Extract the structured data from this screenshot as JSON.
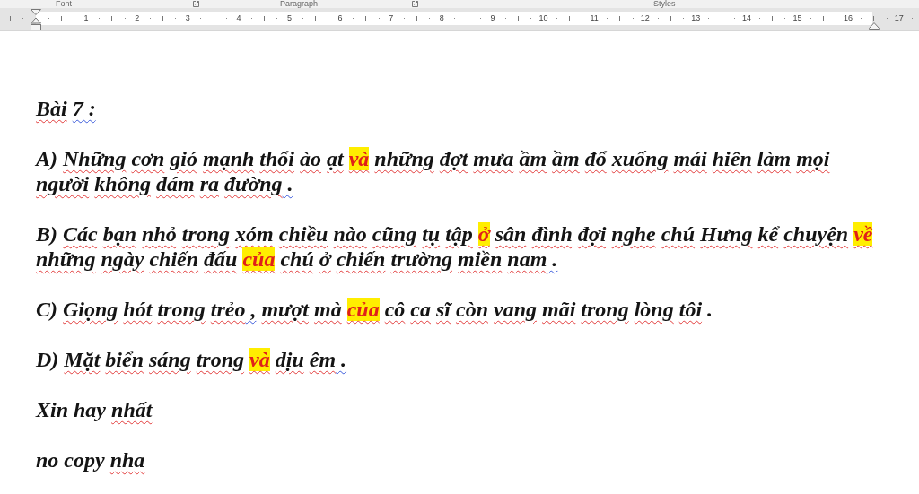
{
  "ribbon": {
    "groups": [
      {
        "label": "Font",
        "launcher": true
      },
      {
        "label": "Paragraph",
        "launcher": true
      },
      {
        "label": "Styles",
        "launcher": false
      }
    ]
  },
  "ruler": {
    "labels": [
      "1",
      "2",
      "3",
      "4",
      "5",
      "6",
      "7",
      "8",
      "9",
      "10",
      "11",
      "12",
      "13",
      "14",
      "15",
      "16",
      "17"
    ]
  },
  "document": {
    "title": {
      "runs": [
        {
          "text": "Bài ",
          "highlighted": false,
          "misspelled": true,
          "grammar_flag": false
        },
        {
          "text": "7 :",
          "highlighted": false,
          "misspelled": false,
          "grammar_flag": true
        }
      ]
    },
    "paragraphs": [
      {
        "runs": [
          {
            "text": "A) ",
            "highlighted": false,
            "misspelled": false,
            "grammar_flag": false
          },
          {
            "text": "Những cơn gió mạnh thổi ào ạt ",
            "highlighted": false,
            "misspelled": true,
            "grammar_flag": false
          },
          {
            "text": "và",
            "highlighted": true,
            "misspelled": true,
            "grammar_flag": false
          },
          {
            "text": " những đợt mưa ầm ầm đổ xuống mái hiên làm mọi người không dám ra đường",
            "highlighted": false,
            "misspelled": true,
            "grammar_flag": false
          },
          {
            "text": " .",
            "highlighted": false,
            "misspelled": false,
            "grammar_flag": true
          }
        ]
      },
      {
        "runs": [
          {
            "text": "B) ",
            "highlighted": false,
            "misspelled": false,
            "grammar_flag": false
          },
          {
            "text": "Các bạn nhỏ trong xóm chiều nào cũng tụ tập ",
            "highlighted": false,
            "misspelled": true,
            "grammar_flag": false
          },
          {
            "text": "ở",
            "highlighted": true,
            "misspelled": true,
            "grammar_flag": false
          },
          {
            "text": " sân đình đợi nghe chú Hưng kể chuyện ",
            "highlighted": false,
            "misspelled": true,
            "grammar_flag": false
          },
          {
            "text": "về",
            "highlighted": true,
            "misspelled": true,
            "grammar_flag": false
          },
          {
            "text": " những ngày chiến đấu ",
            "highlighted": false,
            "misspelled": true,
            "grammar_flag": false
          },
          {
            "text": "của",
            "highlighted": true,
            "misspelled": true,
            "grammar_flag": false
          },
          {
            "text": " chú ở chiến trường miền nam",
            "highlighted": false,
            "misspelled": true,
            "grammar_flag": false
          },
          {
            "text": " .",
            "highlighted": false,
            "misspelled": false,
            "grammar_flag": true
          }
        ]
      },
      {
        "runs": [
          {
            "text": "C) ",
            "highlighted": false,
            "misspelled": false,
            "grammar_flag": false
          },
          {
            "text": "Giọng hót trong trẻo",
            "highlighted": false,
            "misspelled": true,
            "grammar_flag": false
          },
          {
            "text": " ,",
            "highlighted": false,
            "misspelled": false,
            "grammar_flag": true
          },
          {
            "text": " mượt mà ",
            "highlighted": false,
            "misspelled": true,
            "grammar_flag": false
          },
          {
            "text": "của",
            "highlighted": true,
            "misspelled": true,
            "grammar_flag": false
          },
          {
            "text": " cô ca sĩ còn vang mãi trong lòng tôi",
            "highlighted": false,
            "misspelled": true,
            "grammar_flag": false
          },
          {
            "text": " .",
            "highlighted": false,
            "misspelled": false,
            "grammar_flag": false
          }
        ]
      },
      {
        "runs": [
          {
            "text": "D) ",
            "highlighted": false,
            "misspelled": false,
            "grammar_flag": false
          },
          {
            "text": "Mặt biển sáng trong ",
            "highlighted": false,
            "misspelled": true,
            "grammar_flag": false
          },
          {
            "text": "và",
            "highlighted": true,
            "misspelled": true,
            "grammar_flag": false
          },
          {
            "text": " dịu êm",
            "highlighted": false,
            "misspelled": true,
            "grammar_flag": false
          },
          {
            "text": " .",
            "highlighted": false,
            "misspelled": false,
            "grammar_flag": true
          }
        ]
      },
      {
        "runs": [
          {
            "text": "Xin hay ",
            "highlighted": false,
            "misspelled": false,
            "grammar_flag": false
          },
          {
            "text": "nhất",
            "highlighted": false,
            "misspelled": true,
            "grammar_flag": false
          }
        ]
      },
      {
        "runs": [
          {
            "text": "no copy ",
            "highlighted": false,
            "misspelled": false,
            "grammar_flag": false
          },
          {
            "text": "nha",
            "highlighted": false,
            "misspelled": true,
            "grammar_flag": false
          }
        ]
      }
    ]
  }
}
